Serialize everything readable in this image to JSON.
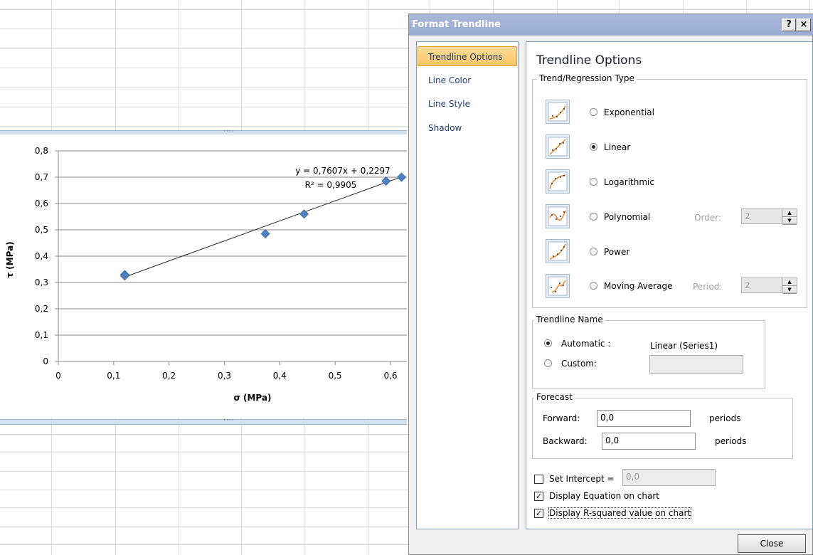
{
  "dialog": {
    "title": "Format Trendline",
    "help_label": "?",
    "close_label": "×",
    "nav": [
      {
        "label": "Trendline Options"
      },
      {
        "label": "Line Color"
      },
      {
        "label": "Line Style"
      },
      {
        "label": "Shadow"
      }
    ],
    "panel_title": "Trendline Options",
    "type_group_label": "Trend/Regression Type",
    "types": [
      {
        "label": "Exponential",
        "selected": false
      },
      {
        "label": "Linear",
        "selected": true
      },
      {
        "label": "Logarithmic",
        "selected": false
      },
      {
        "label": "Polynomial",
        "selected": false
      },
      {
        "label": "Power",
        "selected": false
      },
      {
        "label": "Moving Average",
        "selected": false
      }
    ],
    "order": {
      "label": "Order:",
      "value": "2"
    },
    "period": {
      "label": "Period:",
      "value": "2"
    },
    "name_group_label": "Trendline Name",
    "automatic": {
      "label": "Automatic :",
      "value": "Linear (Series1)",
      "selected": true
    },
    "custom": {
      "label": "Custom:",
      "selected": false
    },
    "forecast_group_label": "Forecast",
    "forward": {
      "label": "Forward:",
      "value": "0,0",
      "unit": "periods"
    },
    "backward": {
      "label": "Backward:",
      "value": "0,0",
      "unit": "periods"
    },
    "set_intercept": {
      "label": "Set Intercept =",
      "value": "0,0",
      "checked": false
    },
    "display_equation": {
      "label": "Display Equation on chart",
      "checked": true
    },
    "display_r2": {
      "label": "Display R-squared value on chart",
      "checked": true
    },
    "close_button": "Close"
  },
  "chart_data": {
    "type": "scatter",
    "xlabel": "σ (MPa)",
    "ylabel": "τ (MPa)",
    "xlim": [
      0,
      0.6
    ],
    "ylim": [
      0,
      0.8
    ],
    "x_ticks": [
      "0",
      "0,1",
      "0,2",
      "0,3",
      "0,4",
      "0,5",
      "0,6"
    ],
    "y_ticks": [
      "0",
      "0,1",
      "0,2",
      "0,3",
      "0,4",
      "0,5",
      "0,6",
      "0,7",
      "0,8"
    ],
    "series": [
      {
        "x": [
          0.12,
          0.12,
          0.374,
          0.444,
          0.592,
          0.62
        ],
        "y": [
          0.33,
          0.325,
          0.485,
          0.56,
          0.685,
          0.7
        ]
      }
    ],
    "trendline": {
      "slope": 0.7607,
      "intercept": 0.2297,
      "x_range": [
        0.12,
        0.62
      ]
    },
    "equation_label": "y = 0,7607x + 0,2297",
    "r2_label": "R² = 0,9905",
    "marker_color": "#4f81bd",
    "grid": true
  }
}
